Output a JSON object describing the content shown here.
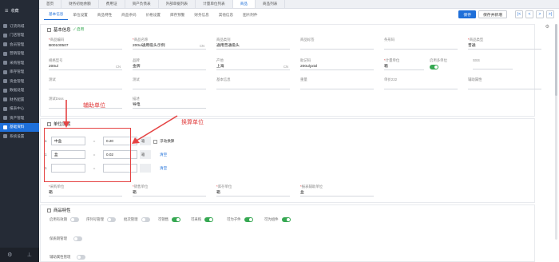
{
  "sidebar": {
    "title": "收藏",
    "items": [
      {
        "label": "订货商城"
      },
      {
        "label": "门店管理"
      },
      {
        "label": "会员管理"
      },
      {
        "label": "营销管理"
      },
      {
        "label": "采购管理"
      },
      {
        "label": "库存管理"
      },
      {
        "label": "资金管理"
      },
      {
        "label": "数据处理"
      },
      {
        "label": "财务配置"
      },
      {
        "label": "报表中心"
      },
      {
        "label": "资产管理"
      },
      {
        "label": "基础资料",
        "active": true
      },
      {
        "label": "系统设置"
      }
    ]
  },
  "tabs": [
    "首页",
    "财务初始余额",
    "费用证",
    "资产负债表",
    "外部单据列表",
    "计量单位列表",
    "商品",
    "商品列表"
  ],
  "active_tab": 6,
  "subtabs": [
    "基本信息",
    "单位设置",
    "商品特性",
    "商品条码",
    "价格设置",
    "库存预警",
    "财务信息",
    "其他信息",
    "图片附件"
  ],
  "buttons": {
    "save": "保存",
    "save_new": "保存并新增",
    "first": "|<",
    "prev": "<",
    "next": ">",
    "last": ">|"
  },
  "basic": {
    "title": "基本信息",
    "status": "启用",
    "fields": [
      {
        "label": "商品编码",
        "req": true,
        "value": "B00100507"
      },
      {
        "label": "商品名称",
        "req": true,
        "value": "200ul通用吸头示例",
        "suffix": "CN"
      },
      {
        "label": "商品类别",
        "req": false,
        "value": "通用普通吸头"
      },
      {
        "label": "商品标签",
        "req": false,
        "value": ""
      },
      {
        "label": "条形码",
        "req": false,
        "value": ""
      },
      {
        "label": "商品类型",
        "req": true,
        "value": "普通"
      },
      {
        "label": "规格型号",
        "req": false,
        "value": "200ul",
        "suffix": "CN"
      },
      {
        "label": "品牌",
        "req": false,
        "value": "金牌"
      },
      {
        "label": "产地",
        "req": false,
        "value": "上海",
        "suffix": "CN"
      },
      {
        "label": "助记码",
        "req": false,
        "value": "200ulyxtxl"
      },
      {
        "label": "计量单位",
        "req": true,
        "value": "箱"
      },
      {
        "label": "启用多单位",
        "req": false,
        "toggle": true
      },
      {
        "label": "SSS",
        "req": false,
        "value": ""
      },
      {
        "label": "测试",
        "req": false,
        "value": ""
      },
      {
        "label": "测试",
        "req": false,
        "value": ""
      },
      {
        "label": "基本信息",
        "req": false,
        "value": ""
      },
      {
        "label": "重量",
        "req": false,
        "value": ""
      },
      {
        "label": "单价222",
        "req": false,
        "value": ""
      },
      {
        "label": "辅助属性",
        "req": false,
        "value": ""
      },
      {
        "label": "测试Dsss",
        "req": false,
        "value": ""
      },
      {
        "label": "描述",
        "req": false,
        "value": "导电"
      }
    ]
  },
  "units": {
    "title": "单位设置",
    "float_label": "浮动换算",
    "clear_label": "清空",
    "rows": [
      {
        "idx": "1",
        "unit": "中盒",
        "ratio": "0.20",
        "base": "箱"
      },
      {
        "idx": "1",
        "unit": "盒",
        "ratio": "0.02",
        "base": "箱"
      },
      {
        "idx": "1",
        "unit": "",
        "ratio": "",
        "base": ""
      }
    ],
    "bottom": [
      {
        "label": "采购单位",
        "value": "箱"
      },
      {
        "label": "销售单位",
        "value": "箱"
      },
      {
        "label": "库存单位",
        "value": "箱"
      },
      {
        "label": "报表辅助单位",
        "value": "盒"
      }
    ]
  },
  "features": {
    "title": "商品特性",
    "row1": [
      {
        "label": "启用有效期",
        "on": false
      },
      {
        "label": "序列号管理",
        "on": false
      },
      {
        "label": "批次管理",
        "on": false
      },
      {
        "label": "可销售",
        "on": true
      },
      {
        "label": "可采购",
        "on": true
      },
      {
        "label": "可为子件",
        "on": true
      },
      {
        "label": "可为组件",
        "on": true
      }
    ],
    "row2_label": "保质期管理",
    "row3_label": "辅助属性管理"
  },
  "annotations": {
    "aux_unit": "辅助单位",
    "conv_unit": "换算单位"
  }
}
